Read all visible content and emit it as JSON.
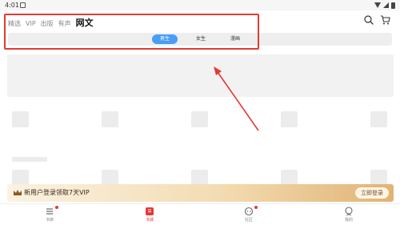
{
  "status_bar": {
    "time": "4:01"
  },
  "top_nav": {
    "tabs": [
      {
        "label": "精选",
        "active": false
      },
      {
        "label": "VIP",
        "active": false
      },
      {
        "label": "出版",
        "active": false
      },
      {
        "label": "有声",
        "active": false
      },
      {
        "label": "网文",
        "active": true
      }
    ],
    "icons": [
      "search-icon",
      "cart-icon"
    ]
  },
  "sub_tabs": [
    {
      "label": "男生",
      "active": true
    },
    {
      "label": "女生",
      "active": false
    },
    {
      "label": "漫画",
      "active": false
    }
  ],
  "vip_banner": {
    "text": "新用户登录领取7天VIP",
    "button_label": "立即登录",
    "icon": "crown-icon"
  },
  "bottom_nav": [
    {
      "label": "书架",
      "icon": "bookshelf-icon",
      "active": false,
      "badge": true
    },
    {
      "label": "书城",
      "icon": "bookstore-icon",
      "active": true,
      "badge": false
    },
    {
      "label": "社区",
      "icon": "community-icon",
      "active": false,
      "badge": true
    },
    {
      "label": "我的",
      "icon": "profile-icon",
      "active": false,
      "badge": false
    }
  ],
  "colors": {
    "accent": "#e53935",
    "tab_active": "#4a9df5",
    "highlight": "#e53935",
    "vip_gold": "#e1b374"
  }
}
